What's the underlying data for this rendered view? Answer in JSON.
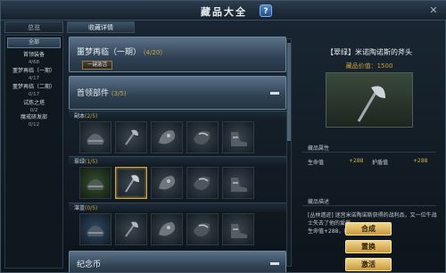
{
  "window": {
    "title": "藏品大全",
    "help_icon": "?",
    "close_icon": "✕"
  },
  "tabs": [
    "总览",
    "收藏详情"
  ],
  "sidebar": [
    {
      "label": "全部",
      "count": ""
    },
    {
      "label": "首领装备",
      "count": "4/68"
    },
    {
      "label": "噩梦再临（一期）",
      "count": "4/17"
    },
    {
      "label": "噩梦再临（二期）",
      "count": "0/17"
    },
    {
      "label": "试炼之塔",
      "count": "0/2"
    },
    {
      "label": "魔戒研发部",
      "count": "0/12"
    }
  ],
  "sets": {
    "nightmare": {
      "name": "噩梦再临（一期）",
      "count": "(4/20)",
      "button": "一键激活"
    },
    "boss": {
      "name": "首领部件",
      "count": "(3/5)"
    },
    "next": {
      "name": "纪念币"
    }
  },
  "rows": [
    {
      "label": "副本",
      "count": "(2/5)"
    },
    {
      "label": "翠绿",
      "count": "(1/5)"
    },
    {
      "label": "湛蓝",
      "count": "(0/5)"
    }
  ],
  "item": {
    "title": "【翠绿】米诺陶诺斯的斧头",
    "price_label": "藏品价值：1500",
    "attr_title": "藏品属性",
    "stat1_name": "生命值",
    "stat1_val": "+288",
    "stat2_name": "护盾值",
    "stat2_val": "+288",
    "desc_title": "藏品描述",
    "desc": "[丛林遗迹] 迷宫米诺陶诺斯获得的战利品，又一位牛战士失去了他的爱斧",
    "desc_stats": "生命值+288，护盾值+288"
  },
  "actions": {
    "combine": "合成",
    "replace": "置换",
    "activate": "激活"
  },
  "colors": {
    "accent": "#c9a341",
    "select": "#d5a640"
  }
}
